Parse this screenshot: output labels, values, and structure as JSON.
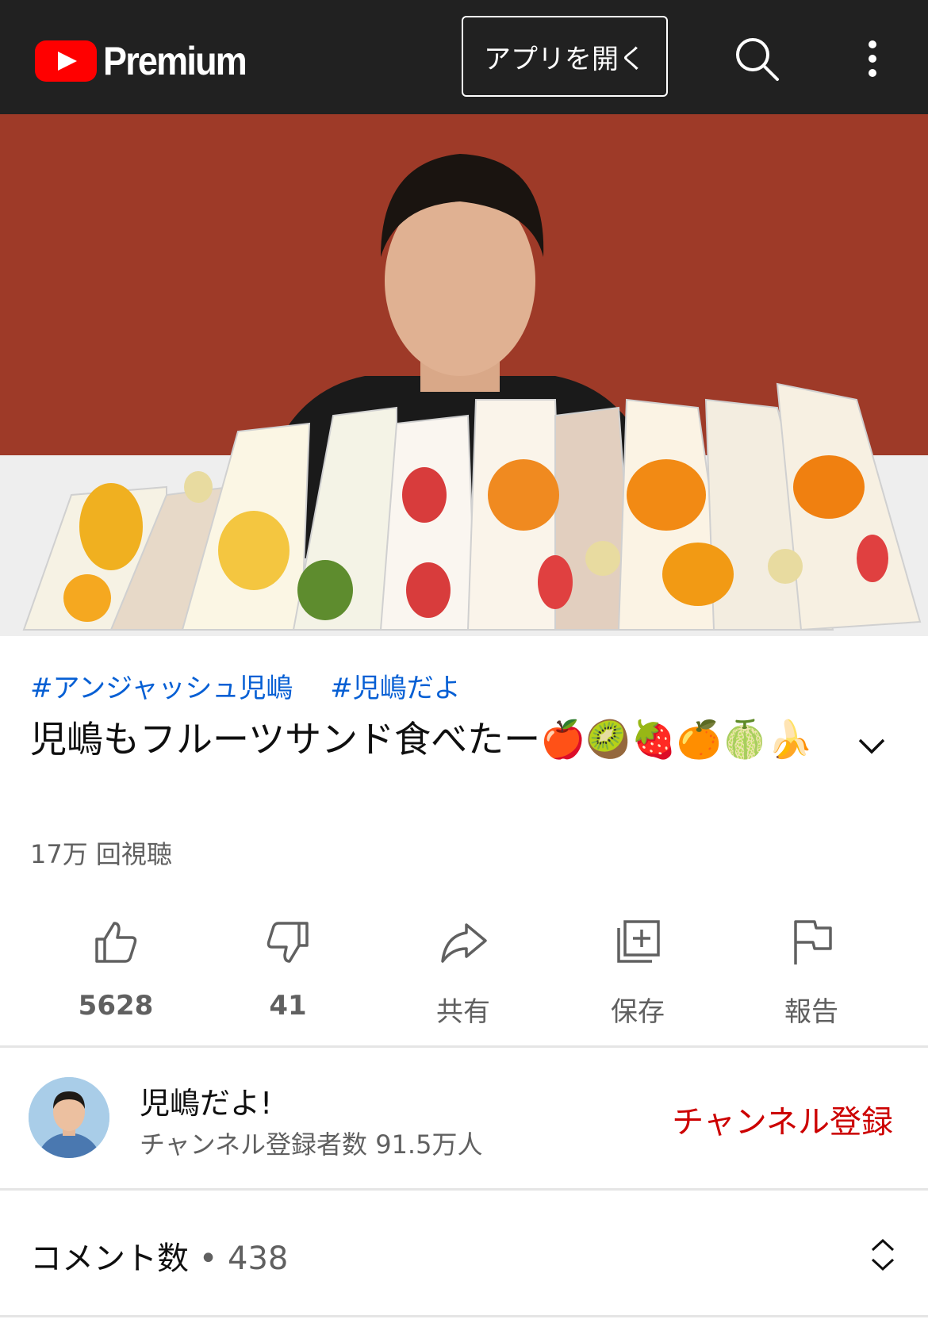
{
  "header": {
    "logo_text": "Premium",
    "open_app_label": "アプリを開く"
  },
  "video": {
    "hashtags": [
      "#アンジャッシュ児嶋",
      "#児嶋だよ"
    ],
    "title": "児嶋もフルーツサンド食べたー🍎🥝🍓🍊🍈🍌",
    "views": "17万 回視聴"
  },
  "actions": {
    "like": "5628",
    "dislike": "41",
    "share": "共有",
    "save": "保存",
    "report": "報告"
  },
  "channel": {
    "name": "児嶋だよ!",
    "subscribers": "チャンネル登録者数 91.5万人",
    "subscribe_label": "チャンネル登録"
  },
  "comments": {
    "label": "コメント数",
    "separator": " • ",
    "count": "438"
  },
  "colors": {
    "accent_red": "#cc0000",
    "brand_red": "#ff0000",
    "link_blue": "#065fd4",
    "header_bg": "#212121"
  }
}
